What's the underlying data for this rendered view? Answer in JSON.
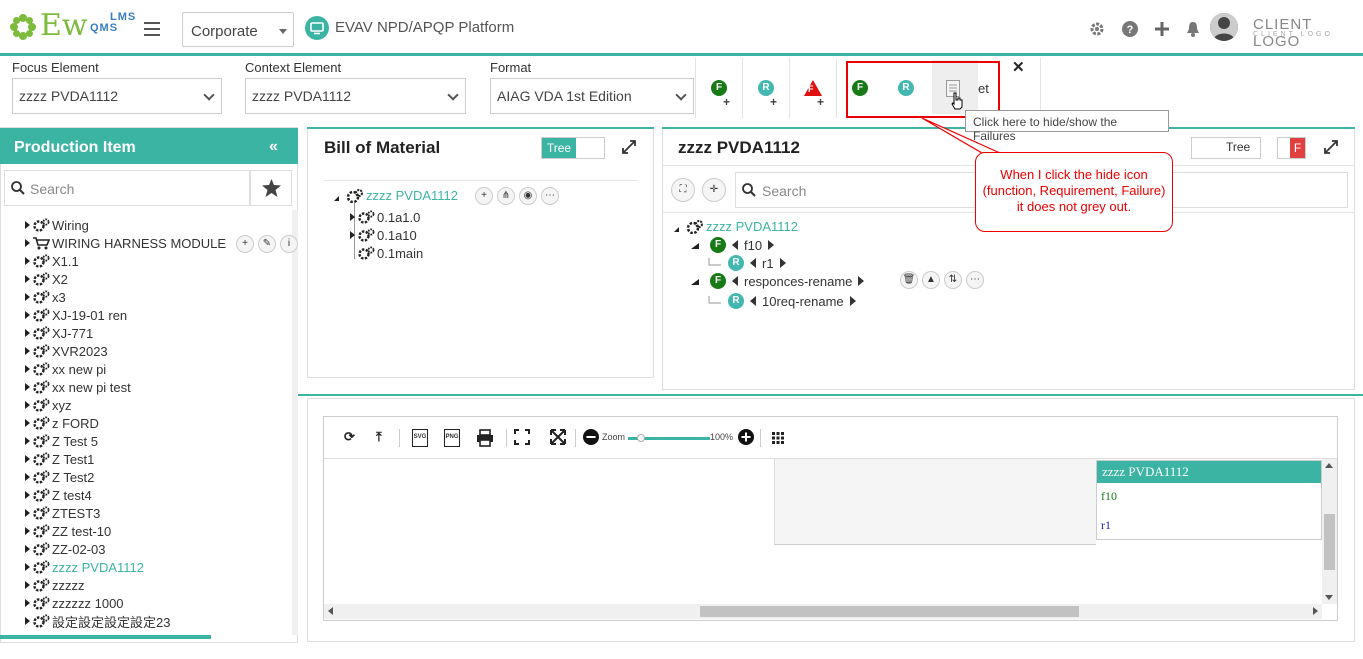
{
  "header": {
    "logo_main": "Ew",
    "logo_line1": "LMS",
    "logo_line2": "QMS",
    "org_select": "Corporate",
    "platform_title": "EVAV NPD/APQP Platform",
    "client_logo": "CLIENT LOGO",
    "client_logo_sub": "CLIENT LOGO"
  },
  "filters": {
    "focus_label": "Focus Element",
    "focus_value": "zzzz PVDA1112",
    "context_label": "Context Element",
    "context_value": "zzzz PVDA1112",
    "format_label": "Format",
    "format_value": "AIAG VDA 1st Edition",
    "badge_f": "F",
    "badge_r": "R",
    "badge_warn": "F",
    "plus": "+",
    "hidden_label": "et",
    "close": "✕"
  },
  "tooltip": "Click here to hide/show the Failures",
  "callout": "When I click the hide icon (function, Requirement, Failure) it does not grey out.",
  "left_panel": {
    "title": "Production Item",
    "search_placeholder": "Search",
    "items": [
      {
        "label": "Wiring"
      },
      {
        "label": "WIRING HARNESS MODULE"
      },
      {
        "label": "X1.1"
      },
      {
        "label": "X2"
      },
      {
        "label": "x3"
      },
      {
        "label": "XJ-19-01 ren"
      },
      {
        "label": "XJ-771"
      },
      {
        "label": "XVR2023"
      },
      {
        "label": "xx new pi"
      },
      {
        "label": "xx new pi test"
      },
      {
        "label": "xyz"
      },
      {
        "label": "z FORD"
      },
      {
        "label": "Z Test 5"
      },
      {
        "label": "Z Test1"
      },
      {
        "label": "Z Test2"
      },
      {
        "label": "Z test4"
      },
      {
        "label": "ZTEST3"
      },
      {
        "label": "ZZ test-10"
      },
      {
        "label": "ZZ-02-03"
      },
      {
        "label": "zzzz PVDA1112"
      },
      {
        "label": "zzzzz"
      },
      {
        "label": "zzzzzz 1000"
      },
      {
        "label": "設定設定設定設定23"
      }
    ]
  },
  "bom": {
    "title": "Bill of Material",
    "toggle": "Tree",
    "root": "zzzz PVDA1112",
    "children": [
      "0.1a1.0",
      "0.1a10",
      "0.1main"
    ]
  },
  "detail": {
    "title": "zzzz PVDA1112",
    "toggle": "Tree",
    "toggle_flag": "F",
    "search_placeholder": "Search",
    "root": "zzzz PVDA1112",
    "nodes": [
      {
        "type": "F",
        "label": "f10"
      },
      {
        "type": "R",
        "label": "r1"
      },
      {
        "type": "F",
        "label": "responces-rename"
      },
      {
        "type": "R",
        "label": "10req-rename"
      }
    ]
  },
  "bottom": {
    "zoom_label": "Zoom",
    "zoom_pct": "100%",
    "zoom_level": 1.0,
    "card_title": "zzzz PVDA1112",
    "card_rows": [
      "f10",
      "r1"
    ]
  },
  "colors": {
    "accent": "#3cb4a4",
    "function_green": "#177a17",
    "requirement_teal": "#44b8b0",
    "highlight_red": "#ee0000"
  }
}
